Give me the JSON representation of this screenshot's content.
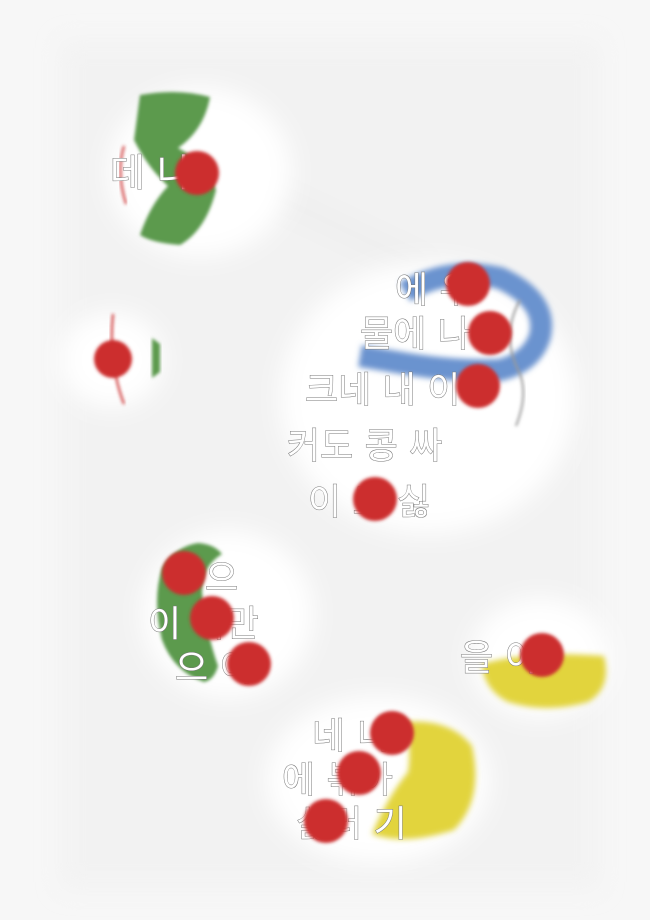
{
  "colors": {
    "background": "#f7f7f7",
    "spot": "#ffffff",
    "green": "#5b9a4e",
    "blue": "#6a93cf",
    "yellow": "#e2d43c",
    "red_dot": "#cc2f2f",
    "text_outline": "#777777"
  },
  "spots": {
    "s1": {
      "text": [
        "데 나"
      ]
    },
    "s2": {
      "text": [
        "에 우",
        "물에 나",
        "크네 내 이",
        "커도 콩 싸",
        "이 도 싫"
      ]
    },
    "s4": {
      "text": [
        "으",
        "이 짝만",
        "으 이"
      ]
    },
    "s5": {
      "text": [
        "을 이"
      ]
    },
    "s6": {
      "text": [
        "네 니",
        "에 볶아",
        "싫러 기"
      ]
    }
  }
}
